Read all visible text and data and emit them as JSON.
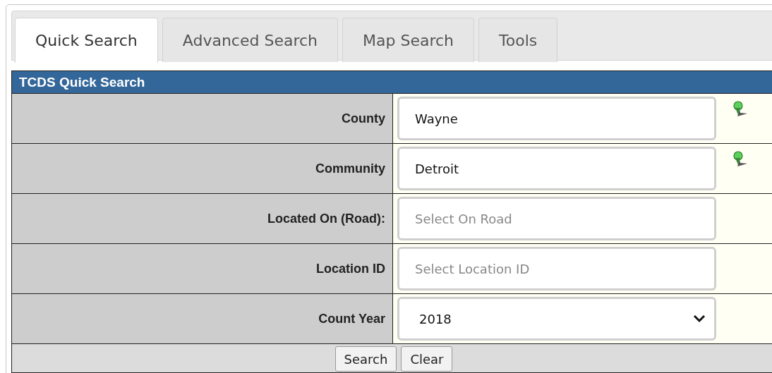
{
  "tabs": [
    {
      "label": "Quick Search",
      "selected": true
    },
    {
      "label": "Advanced Search",
      "selected": false
    },
    {
      "label": "Map Search",
      "selected": false
    },
    {
      "label": "Tools",
      "selected": false
    }
  ],
  "panel": {
    "title": "TCDS Quick Search",
    "fields": [
      {
        "label": "County",
        "kind": "text",
        "value": "Wayne",
        "pin": true
      },
      {
        "label": "Community",
        "kind": "text",
        "value": "Detroit",
        "pin": true
      },
      {
        "label": "Located On (Road):",
        "kind": "text",
        "placeholder": "Select On Road",
        "pin": false
      },
      {
        "label": "Location ID",
        "kind": "text",
        "placeholder": "Select Location ID",
        "pin": false
      },
      {
        "label": "Count Year",
        "kind": "select",
        "value": "2018",
        "pin": false
      }
    ],
    "buttons": [
      "Search",
      "Clear"
    ]
  }
}
